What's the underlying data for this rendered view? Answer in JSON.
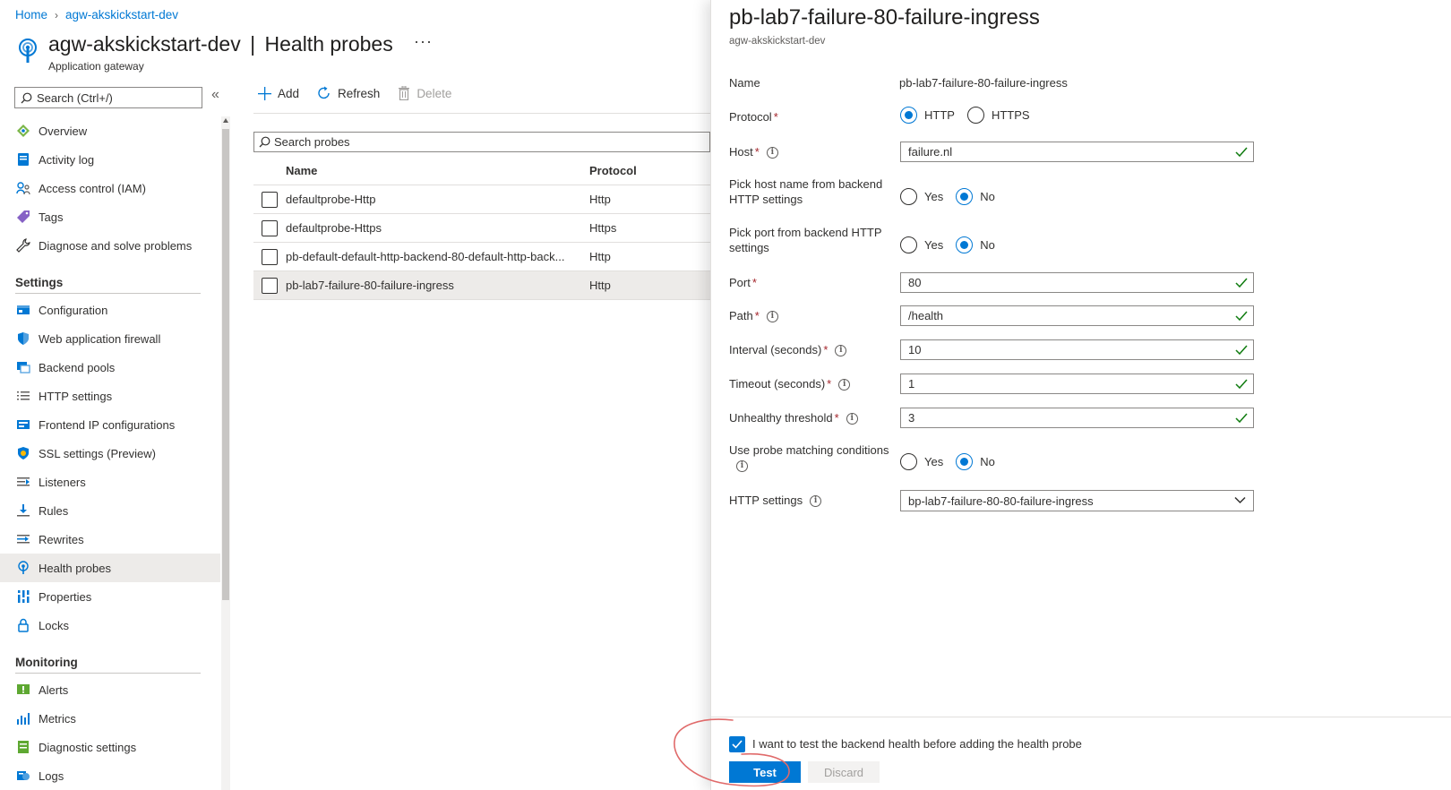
{
  "breadcrumb": {
    "home": "Home",
    "resource": "agw-akskickstart-dev"
  },
  "header": {
    "resource_name": "agw-akskickstart-dev",
    "separator": "|",
    "page": "Health probes",
    "more": "···",
    "resource_type": "Application gateway"
  },
  "nav": {
    "search_placeholder": "Search (Ctrl+/)",
    "collapse": "«",
    "top_items": [
      {
        "label": "Overview",
        "icon": "overview-icon"
      },
      {
        "label": "Activity log",
        "icon": "activity-log-icon"
      },
      {
        "label": "Access control (IAM)",
        "icon": "iam-icon"
      },
      {
        "label": "Tags",
        "icon": "tag-icon"
      },
      {
        "label": "Diagnose and solve problems",
        "icon": "wrench-icon"
      }
    ],
    "settings_header": "Settings",
    "settings_items": [
      {
        "label": "Configuration",
        "icon": "configuration-icon"
      },
      {
        "label": "Web application firewall",
        "icon": "shield-icon"
      },
      {
        "label": "Backend pools",
        "icon": "backend-pool-icon"
      },
      {
        "label": "HTTP settings",
        "icon": "list-icon"
      },
      {
        "label": "Frontend IP configurations",
        "icon": "frontend-ip-icon"
      },
      {
        "label": "SSL settings (Preview)",
        "icon": "ssl-shield-icon"
      },
      {
        "label": "Listeners",
        "icon": "listener-icon"
      },
      {
        "label": "Rules",
        "icon": "rules-icon"
      },
      {
        "label": "Rewrites",
        "icon": "rewrites-icon"
      },
      {
        "label": "Health probes",
        "icon": "health-probe-icon",
        "active": true
      },
      {
        "label": "Properties",
        "icon": "properties-icon"
      },
      {
        "label": "Locks",
        "icon": "lock-icon"
      }
    ],
    "monitoring_header": "Monitoring",
    "monitoring_items": [
      {
        "label": "Alerts",
        "icon": "alerts-icon"
      },
      {
        "label": "Metrics",
        "icon": "metrics-icon"
      },
      {
        "label": "Diagnostic settings",
        "icon": "diagnostic-settings-icon"
      },
      {
        "label": "Logs",
        "icon": "logs-icon"
      }
    ]
  },
  "toolbar": {
    "add": "Add",
    "refresh": "Refresh",
    "delete": "Delete"
  },
  "grid": {
    "search_placeholder": "Search probes",
    "columns": {
      "name": "Name",
      "protocol": "Protocol"
    },
    "rows": [
      {
        "name": "defaultprobe-Http",
        "protocol": "Http"
      },
      {
        "name": "defaultprobe-Https",
        "protocol": "Https"
      },
      {
        "name": "pb-default-default-http-backend-80-default-http-back...",
        "protocol": "Http"
      },
      {
        "name": "pb-lab7-failure-80-failure-ingress",
        "protocol": "Http",
        "selected": true
      }
    ]
  },
  "blade": {
    "title": "pb-lab7-failure-80-failure-ingress",
    "subtitle": "agw-akskickstart-dev",
    "name_label": "Name",
    "name_value": "pb-lab7-failure-80-failure-ingress",
    "protocol_label": "Protocol",
    "protocol_options": [
      "HTTP",
      "HTTPS"
    ],
    "protocol_selected": "HTTP",
    "host_label": "Host",
    "host_value": "failure.nl",
    "pick_host_label": "Pick host name from backend HTTP settings",
    "pick_port_label": "Pick port from backend HTTP settings",
    "yes": "Yes",
    "no": "No",
    "pick_host_selected": "No",
    "pick_port_selected": "No",
    "port_label": "Port",
    "port_value": "80",
    "path_label": "Path",
    "path_value": "/health",
    "interval_label": "Interval (seconds)",
    "interval_value": "10",
    "timeout_label": "Timeout (seconds)",
    "timeout_value": "1",
    "unhealthy_label": "Unhealthy threshold",
    "unhealthy_value": "3",
    "matching_label": "Use probe matching conditions",
    "matching_selected": "No",
    "http_settings_label": "HTTP settings",
    "http_settings_value": "bp-lab7-failure-80-80-failure-ingress",
    "required_mark": "*",
    "info": "i",
    "test_checkbox_label": "I want to test the backend health before adding the health probe",
    "test_checkbox_checked": true,
    "test_button": "Test",
    "discard_button": "Discard"
  },
  "colors": {
    "accent": "#0078d4",
    "valid": "#107c10",
    "required": "#a4262c",
    "annotation": "#e06a6a"
  }
}
